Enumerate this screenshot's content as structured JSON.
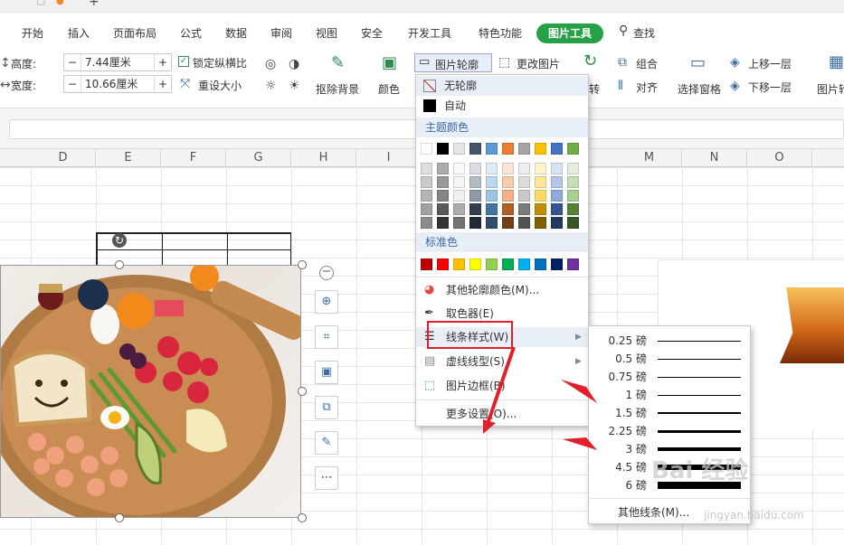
{
  "menu": {
    "tabs": [
      "开始",
      "插入",
      "页面布局",
      "公式",
      "数据",
      "审阅",
      "视图",
      "安全",
      "开发工具",
      "特色功能"
    ],
    "active_tab": "图片工具",
    "search": "查找"
  },
  "ribbon": {
    "height_label": "高度:",
    "height_value": "7.44厘米",
    "width_label": "宽度:",
    "width_value": "10.66厘米",
    "lock_ratio": "锁定纵横比",
    "reset_size": "重设大小",
    "remove_bg": "抠除背景",
    "color": "颜色",
    "picture_outline": "图片轮廓",
    "change_picture": "更改图片",
    "rotate": "转",
    "group": "组合",
    "align": "对齐",
    "selection_pane": "选择窗格",
    "bring_forward": "上移一层",
    "send_backward": "下移一层",
    "picture_more": "图片轮"
  },
  "columns": [
    "D",
    "E",
    "F",
    "G",
    "H",
    "I",
    "M",
    "N",
    "O"
  ],
  "outline_menu": {
    "no_outline": "无轮廓",
    "auto": "自动",
    "theme_colors_header": "主题颜色",
    "standard_colors_header": "标准色",
    "more_colors": "其他轮廓颜色(M)...",
    "eyedropper": "取色器(E)",
    "line_style": "线条样式(W)",
    "dash_style": "虚线线型(S)",
    "picture_border": "图片边框(B)",
    "more_settings": "更多设置(O)...",
    "theme_top_row": [
      "#ffffff",
      "#000000",
      "#e7e6e6",
      "#44546a",
      "#5b9bd5",
      "#ed7d31",
      "#a5a5a5",
      "#ffc000",
      "#4472c4",
      "#70ad47"
    ],
    "standard_colors": [
      "#c00000",
      "#ff0000",
      "#ffc000",
      "#ffff00",
      "#92d050",
      "#00b050",
      "#00b0f0",
      "#0070c0",
      "#002060",
      "#7030a0"
    ]
  },
  "line_style_menu": {
    "options": [
      {
        "label": "0.25 磅",
        "weight": 0.25
      },
      {
        "label": "0.5 磅",
        "weight": 0.5
      },
      {
        "label": "0.75 磅",
        "weight": 0.75
      },
      {
        "label": "1 磅",
        "weight": 1
      },
      {
        "label": "1.5 磅",
        "weight": 1.5
      },
      {
        "label": "2.25 磅",
        "weight": 2.25
      },
      {
        "label": "3 磅",
        "weight": 3
      },
      {
        "label": "4.5 磅",
        "weight": 4.5
      },
      {
        "label": "6 磅",
        "weight": 6
      }
    ],
    "more_lines": "其他线条(M)..."
  },
  "watermark": {
    "brand": "Bai 经验",
    "url": "jingyan.baidu.com"
  }
}
